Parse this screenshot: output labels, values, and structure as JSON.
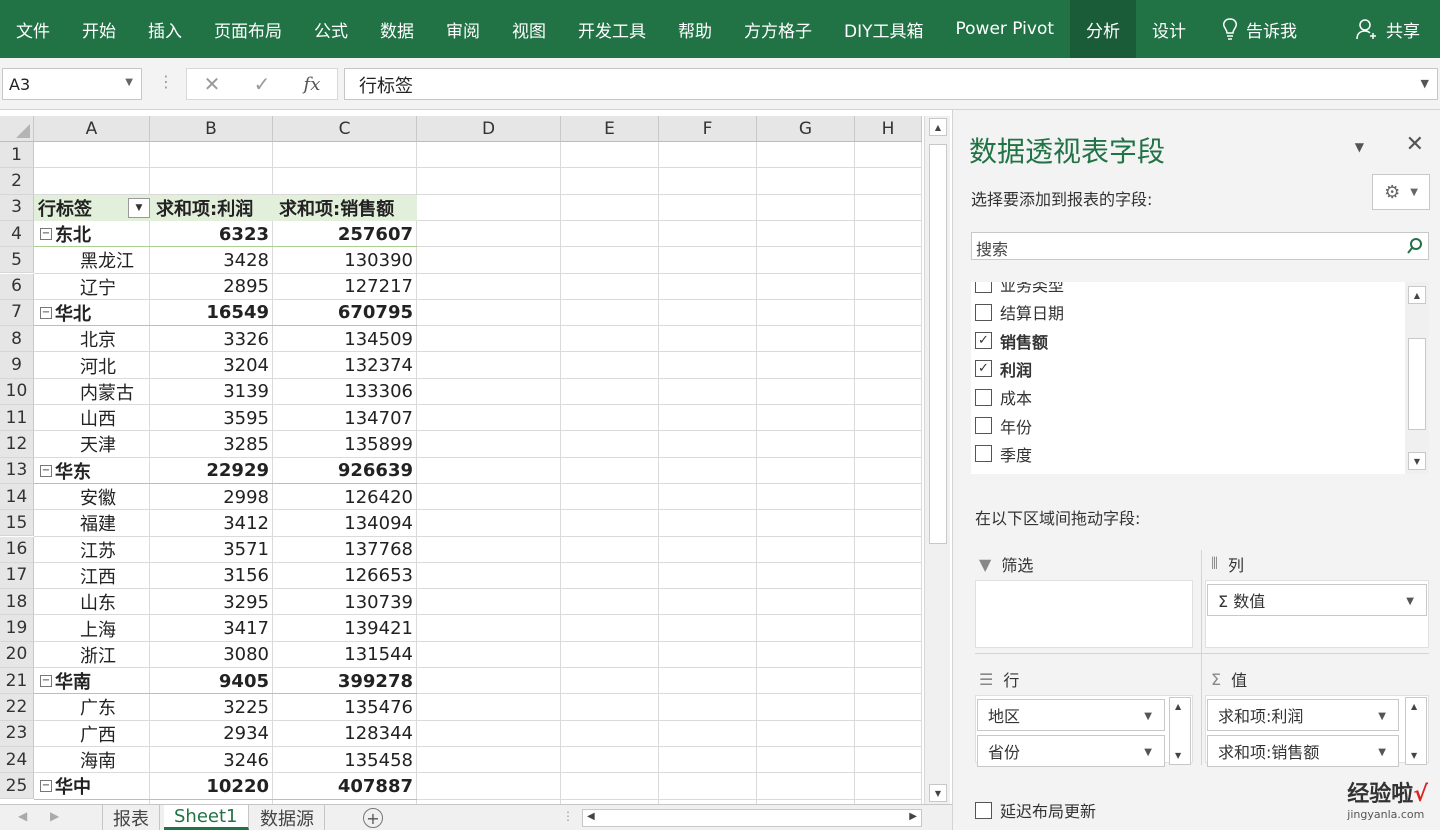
{
  "ribbon": {
    "tabs": [
      "文件",
      "开始",
      "插入",
      "页面布局",
      "公式",
      "数据",
      "审阅",
      "视图",
      "开发工具",
      "帮助",
      "方方格子",
      "DIY工具箱",
      "Power Pivot"
    ],
    "context_tabs": [
      "分析",
      "设计"
    ],
    "tell_me": "告诉我",
    "share": "共享"
  },
  "formula_bar": {
    "name_box": "A3",
    "content": "行标签"
  },
  "sheet": {
    "columns": [
      "A",
      "B",
      "C",
      "D",
      "E",
      "F",
      "G",
      "H"
    ],
    "rows": [
      "1",
      "2",
      "3",
      "4",
      "5",
      "6",
      "7",
      "8",
      "9",
      "10",
      "11",
      "12",
      "13",
      "14",
      "15",
      "16",
      "17",
      "18",
      "19",
      "20",
      "21",
      "22",
      "23",
      "24",
      "25"
    ],
    "pivot_header": [
      "行标签",
      "求和项:利润",
      "求和项:销售额"
    ],
    "pivot_rows": [
      {
        "label": "东北",
        "profit": "6323",
        "sales": "257607",
        "group": true
      },
      {
        "label": "黑龙江",
        "profit": "3428",
        "sales": "130390",
        "group": false
      },
      {
        "label": "辽宁",
        "profit": "2895",
        "sales": "127217",
        "group": false
      },
      {
        "label": "华北",
        "profit": "16549",
        "sales": "670795",
        "group": true
      },
      {
        "label": "北京",
        "profit": "3326",
        "sales": "134509",
        "group": false
      },
      {
        "label": "河北",
        "profit": "3204",
        "sales": "132374",
        "group": false
      },
      {
        "label": "内蒙古",
        "profit": "3139",
        "sales": "133306",
        "group": false
      },
      {
        "label": "山西",
        "profit": "3595",
        "sales": "134707",
        "group": false
      },
      {
        "label": "天津",
        "profit": "3285",
        "sales": "135899",
        "group": false
      },
      {
        "label": "华东",
        "profit": "22929",
        "sales": "926639",
        "group": true
      },
      {
        "label": "安徽",
        "profit": "2998",
        "sales": "126420",
        "group": false
      },
      {
        "label": "福建",
        "profit": "3412",
        "sales": "134094",
        "group": false
      },
      {
        "label": "江苏",
        "profit": "3571",
        "sales": "137768",
        "group": false
      },
      {
        "label": "江西",
        "profit": "3156",
        "sales": "126653",
        "group": false
      },
      {
        "label": "山东",
        "profit": "3295",
        "sales": "130739",
        "group": false
      },
      {
        "label": "上海",
        "profit": "3417",
        "sales": "139421",
        "group": false
      },
      {
        "label": "浙江",
        "profit": "3080",
        "sales": "131544",
        "group": false
      },
      {
        "label": "华南",
        "profit": "9405",
        "sales": "399278",
        "group": true
      },
      {
        "label": "广东",
        "profit": "3225",
        "sales": "135476",
        "group": false
      },
      {
        "label": "广西",
        "profit": "2934",
        "sales": "128344",
        "group": false
      },
      {
        "label": "海南",
        "profit": "3246",
        "sales": "135458",
        "group": false
      },
      {
        "label": "华中",
        "profit": "10220",
        "sales": "407887",
        "group": true
      }
    ],
    "tabs": [
      "报表",
      "Sheet1",
      "数据源"
    ],
    "active_tab": "Sheet1"
  },
  "pivot_pane": {
    "title": "数据透视表字段",
    "subtitle": "选择要添加到报表的字段:",
    "search_placeholder": "搜索",
    "fields": [
      {
        "name": "业务类型",
        "checked": false,
        "bold": false
      },
      {
        "name": "结算日期",
        "checked": false,
        "bold": false
      },
      {
        "name": "销售额",
        "checked": true,
        "bold": true
      },
      {
        "name": "利润",
        "checked": true,
        "bold": true
      },
      {
        "name": "成本",
        "checked": false,
        "bold": false
      },
      {
        "name": "年份",
        "checked": false,
        "bold": false
      },
      {
        "name": "季度",
        "checked": false,
        "bold": false
      }
    ],
    "drag_hint": "在以下区域间拖动字段:",
    "areas": {
      "filter_label": "筛选",
      "columns_label": "列",
      "rows_label": "行",
      "values_label": "值",
      "columns_items": [
        "Σ 数值"
      ],
      "rows_items": [
        "地区",
        "省份"
      ],
      "values_items": [
        "求和项:利润",
        "求和项:销售额"
      ]
    },
    "defer_update": "延迟布局更新"
  },
  "watermark": {
    "text": "经验啦",
    "check": "√",
    "url": "jingyanla.com"
  }
}
